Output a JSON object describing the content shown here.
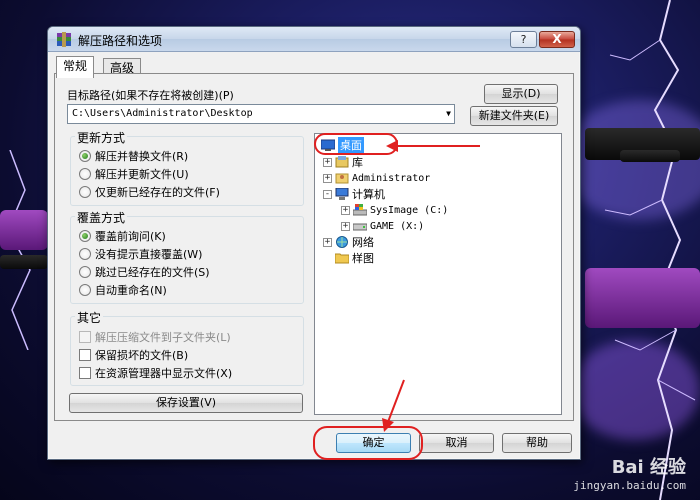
{
  "window": {
    "title": "解压路径和选项",
    "help_label": "?",
    "close_label": "X"
  },
  "tabs": [
    {
      "label": "常规"
    },
    {
      "label": "高级"
    }
  ],
  "target_path": {
    "label": "目标路径(如果不存在将被创建)(P)",
    "value": "C:\\Users\\Administrator\\Desktop"
  },
  "buttons": {
    "show": "显示(D)",
    "new_folder": "新建文件夹(E)",
    "save_settings": "保存设置(V)",
    "ok": "确定",
    "cancel": "取消",
    "help": "帮助"
  },
  "update_mode": {
    "title": "更新方式",
    "options": [
      "解压并替换文件(R)",
      "解压并更新文件(U)",
      "仅更新已经存在的文件(F)"
    ],
    "selected_index": 0
  },
  "overwrite_mode": {
    "title": "覆盖方式",
    "options": [
      "覆盖前询问(K)",
      "没有提示直接覆盖(W)",
      "跳过已经存在的文件(S)",
      "自动重命名(N)"
    ],
    "selected_index": 0
  },
  "misc": {
    "title": "其它",
    "options": [
      {
        "label": "解压压缩文件到子文件夹(L)",
        "enabled": false,
        "checked": false
      },
      {
        "label": "保留损坏的文件(B)",
        "enabled": true,
        "checked": false
      },
      {
        "label": "在资源管理器中显示文件(X)",
        "enabled": true,
        "checked": false
      }
    ]
  },
  "tree": {
    "items": [
      {
        "label": "桌面",
        "icon": "desktop-icon",
        "selected": true
      },
      {
        "label": "库",
        "icon": "library-icon",
        "expander": "+"
      },
      {
        "label": "Administrator",
        "icon": "user-folder-icon",
        "expander": "+"
      },
      {
        "label": "计算机",
        "icon": "computer-icon",
        "expander": "-"
      },
      {
        "label": "SysImage (C:)",
        "icon": "system-drive-icon",
        "expander": "+"
      },
      {
        "label": "GAME (X:)",
        "icon": "drive-icon",
        "expander": "+"
      },
      {
        "label": "网络",
        "icon": "network-icon",
        "expander": "+"
      },
      {
        "label": "样图",
        "icon": "folder-icon"
      }
    ]
  },
  "watermark": {
    "brand": "Bai 经验",
    "url": "jingyan.baidu.com"
  },
  "colors": {
    "selection": "#3399ff",
    "annotation": "#e02020",
    "dialog_bg": "#f0f0f0"
  }
}
